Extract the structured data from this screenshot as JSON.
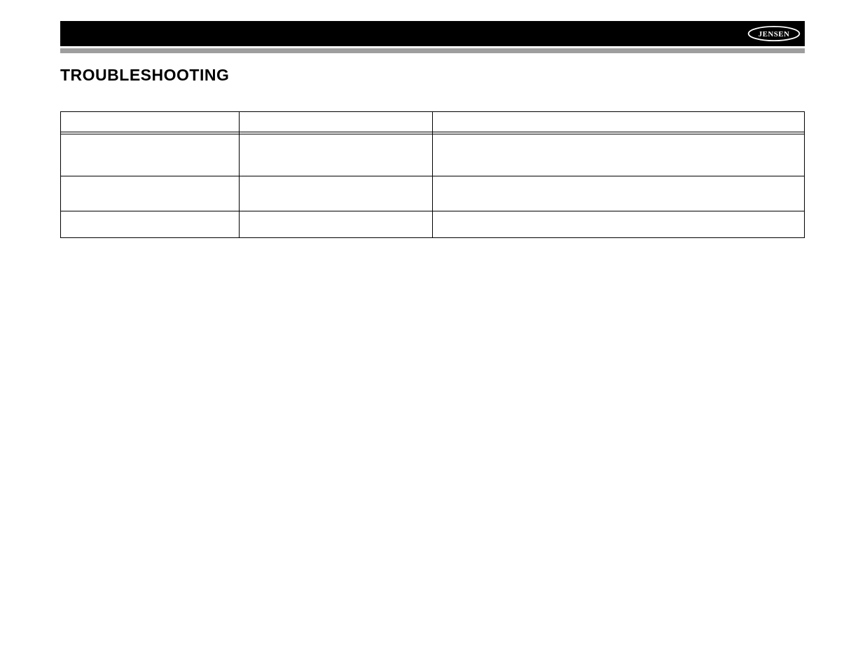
{
  "brand": "JENSEN",
  "section_title": "TROUBLESHOOTING",
  "table": {
    "headers": [
      "",
      "",
      ""
    ],
    "rows": [
      {
        "problem": "",
        "cause": "",
        "action": ""
      },
      {
        "problem": "",
        "cause": "",
        "action": ""
      },
      {
        "problem": "",
        "cause": "",
        "action": ""
      }
    ]
  }
}
